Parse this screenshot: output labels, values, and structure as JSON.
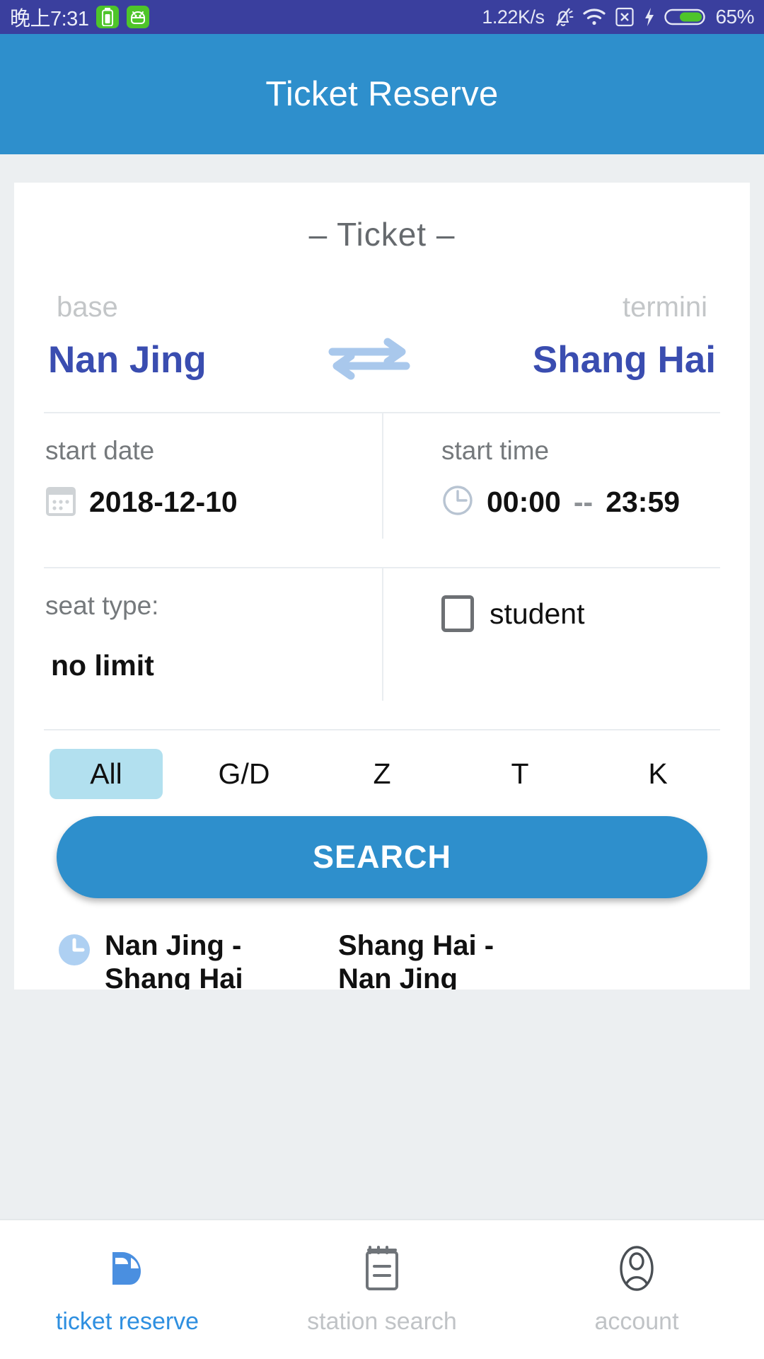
{
  "statusbar": {
    "time": "晚上7:31",
    "network_speed": "1.22K/s",
    "battery_percent": "65%",
    "icons": [
      "battery-app-icon",
      "android-app-icon",
      "bell-muted-icon",
      "wifi-icon",
      "sim-card-x-icon",
      "charging-bolt-icon",
      "battery-icon"
    ]
  },
  "header": {
    "title": "Ticket Reserve"
  },
  "card": {
    "title": "–  Ticket  –",
    "origin_label": "base",
    "destination_label": "termini",
    "origin": "Nan Jing",
    "destination": "Shang Hai",
    "swap_icon": "swap-horizontal-icon",
    "date": {
      "label": "start date",
      "icon": "calendar-icon",
      "value": "2018-12-10"
    },
    "time": {
      "label": "start time",
      "icon": "clock-icon",
      "start": "00:00",
      "separator": "--",
      "end": "23:59"
    },
    "seat": {
      "label": "seat type:",
      "value": "no limit"
    },
    "student": {
      "label": "student",
      "checked": false
    },
    "train_types": [
      {
        "label": "All",
        "selected": true
      },
      {
        "label": "G/D",
        "selected": false
      },
      {
        "label": "Z",
        "selected": false
      },
      {
        "label": "T",
        "selected": false
      },
      {
        "label": "K",
        "selected": false
      }
    ],
    "search_label": "SEARCH",
    "routes": [
      {
        "icon": "clock-filled-icon",
        "text": "Nan Jing - Shang Hai"
      },
      {
        "icon": "",
        "text": "Shang Hai - Nan Jing"
      }
    ]
  },
  "bottomnav": {
    "items": [
      {
        "label": "ticket reserve",
        "icon": "train-head-icon",
        "active": true
      },
      {
        "label": "station search",
        "icon": "clipboard-icon",
        "active": false
      },
      {
        "label": "account",
        "icon": "person-icon",
        "active": false
      }
    ]
  },
  "colors": {
    "statusbar_bg": "#3a3f9e",
    "header_bg": "#2e8fcc",
    "page_bg": "#eceff1",
    "station_text": "#3a4db0",
    "accent": "#2e8fcc",
    "tab_active_bg": "#b2e0ef",
    "nav_active": "#2e8fe0",
    "swap_arrow": "#a9c8ec"
  }
}
